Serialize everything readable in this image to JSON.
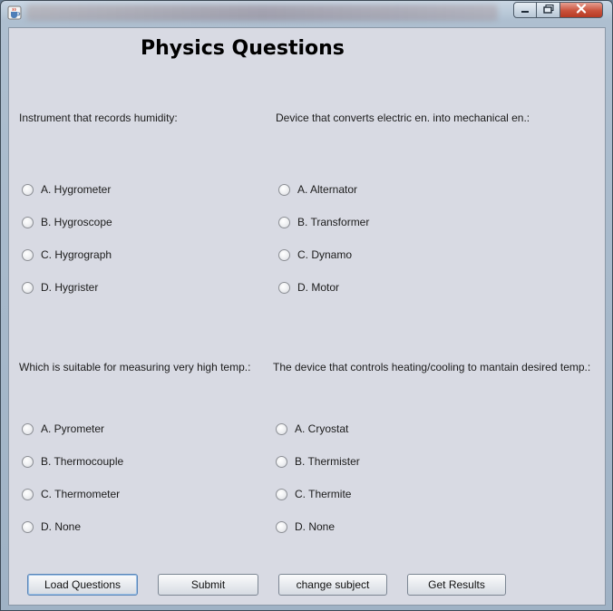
{
  "window": {
    "icon": "java-cup-icon",
    "controls": {
      "minimize": "minimize-icon",
      "maximize": "maximize-icon",
      "close": "close-icon"
    }
  },
  "page": {
    "title": "Physics Questions"
  },
  "questions": [
    {
      "text": "Instrument that records humidity:",
      "options": [
        "A. Hygrometer",
        "B. Hygroscope",
        "C. Hygrograph",
        "D. Hygrister"
      ]
    },
    {
      "text": "Device that converts electric en. into mechanical en.:",
      "options": [
        "A. Alternator",
        "B. Transformer",
        "C. Dynamo",
        "D. Motor"
      ]
    },
    {
      "text": "Which is suitable for measuring very high temp.:",
      "options": [
        "A. Pyrometer",
        "B. Thermocouple",
        "C. Thermometer",
        "D. None"
      ]
    },
    {
      "text": "The device that controls heating/cooling to mantain desired temp.:",
      "options": [
        "A. Cryostat",
        "B. Thermister",
        "C. Thermite",
        "D. None"
      ]
    }
  ],
  "buttons": {
    "load": "Load Questions",
    "submit": "Submit",
    "change": "change subject",
    "results": "Get Results"
  }
}
